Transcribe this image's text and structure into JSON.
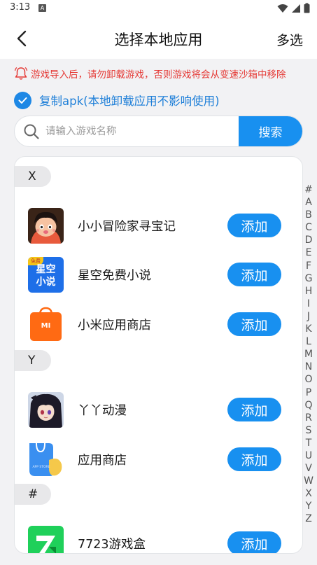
{
  "status_bar": {
    "time": "3:13",
    "notification_glyph": "A"
  },
  "nav": {
    "title": "选择本地应用",
    "action": "多选"
  },
  "warning": {
    "text": "游戏导入后，请勿卸载游戏，否则游戏将会从变速沙箱中移除",
    "color": "#e53935"
  },
  "checkbox": {
    "label": "复制apk(本地卸载应用不影响使用)",
    "checked": true
  },
  "search": {
    "placeholder": "请输入游戏名称",
    "button": "搜索"
  },
  "sections": [
    {
      "header": "X",
      "apps": [
        {
          "name": "小小冒险家寻宝记",
          "icon": "cartoon-boy-icon",
          "button": "添加"
        },
        {
          "name": "星空免费小说",
          "icon": "xingkong-novel-icon",
          "icon_text": [
            "星空",
            "小说"
          ],
          "icon_badge": "免费",
          "button": "添加"
        },
        {
          "name": "小米应用商店",
          "icon": "mi-store-icon",
          "icon_text": "MI",
          "button": "添加"
        }
      ]
    },
    {
      "header": "Y",
      "apps": [
        {
          "name": "丫丫动漫",
          "icon": "anime-girl-icon",
          "button": "添加"
        },
        {
          "name": "应用商店",
          "icon": "app-store-bag-icon",
          "icon_text": "APP STORE",
          "button": "添加"
        }
      ]
    },
    {
      "header": "#",
      "apps": [
        {
          "name": "7723游戏盒",
          "icon": "game-box-icon",
          "button": "添加"
        }
      ]
    }
  ],
  "index_letters": [
    "#",
    "A",
    "B",
    "C",
    "D",
    "E",
    "F",
    "G",
    "H",
    "I",
    "J",
    "K",
    "L",
    "M",
    "N",
    "O",
    "P",
    "Q",
    "R",
    "S",
    "T",
    "U",
    "V",
    "W",
    "X",
    "Y",
    "Z"
  ],
  "colors": {
    "accent": "#1890f0",
    "warning": "#e53935",
    "link": "#1e7fd8"
  }
}
